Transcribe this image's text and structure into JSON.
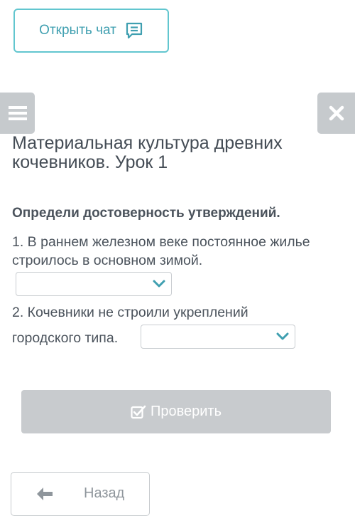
{
  "chat_button": {
    "label": "Открыть чат",
    "icon": "chat-bubble-icon"
  },
  "menu_button": {
    "icon": "hamburger-icon"
  },
  "close_button": {
    "icon": "close-icon"
  },
  "title": "Материальная культура древних кочевников. Урок 1",
  "instruction": "Определи достоверность утверждений.",
  "questions": [
    {
      "text": "1. В раннем железном веке постоянное жилье строилось в основном зимой.",
      "selected": ""
    },
    {
      "text_line1": "2. Кочевники не строили укреплений",
      "text_line2": "городского типа.",
      "selected": ""
    }
  ],
  "check_button": {
    "label": "Проверить",
    "icon": "check-square-icon"
  },
  "back_button": {
    "label": "Назад",
    "icon": "arrow-left-icon"
  },
  "colors": {
    "accent": "#62c6cf",
    "accent_text": "#3f9fb0",
    "disabled": "#c8cbce",
    "side_buttons": "#c6cacd"
  }
}
